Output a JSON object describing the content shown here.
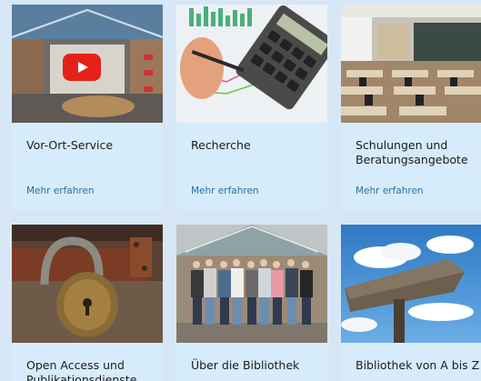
{
  "cards": [
    {
      "title": "Vor-Ort-Service",
      "link": "Mehr erfahren"
    },
    {
      "title": "Recherche",
      "link": "Mehr erfahren"
    },
    {
      "title": "Schulungen und\nBeratungsangebote",
      "link": "Mehr erfahren"
    },
    {
      "title": "Open Access und\nPublikationsdienste"
    },
    {
      "title": "Über die Bibliothek"
    },
    {
      "title": "Bibliothek von A bis Z"
    }
  ],
  "colors": {
    "background": "#d7e7f6",
    "card": "#d6ecfa",
    "link": "#2a6fa5",
    "youtube": "#e62117"
  },
  "icons": [
    "youtube-play-icon"
  ]
}
